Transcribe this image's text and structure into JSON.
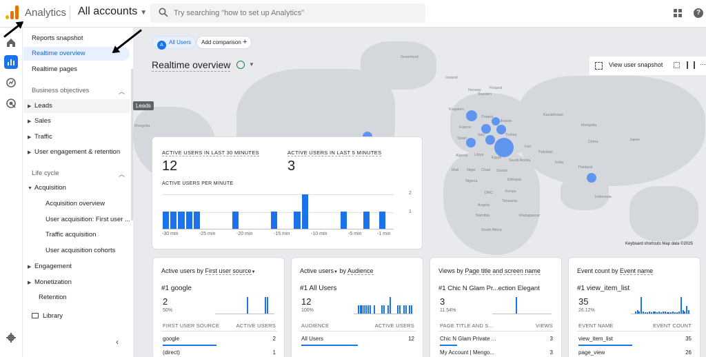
{
  "topbar": {
    "app_name": "Analytics",
    "account": "All accounts",
    "search_placeholder": "Try searching \"how to set up Analytics\""
  },
  "nav": {
    "reports_snapshot": "Reports snapshot",
    "realtime_overview": "Realtime overview",
    "realtime_pages": "Realtime pages",
    "business_objectives": "Business objectives",
    "bo_items": [
      "Leads",
      "Sales",
      "Traffic",
      "User engagement & retention"
    ],
    "life_cycle": "Life cycle",
    "acquisition": "Acquisition",
    "acq_items": [
      "Acquisition overview",
      "User acquisition: First user ...",
      "Traffic acquisition",
      "User acquisition cohorts"
    ],
    "engagement": "Engagement",
    "monetization": "Monetization",
    "retention": "Retention",
    "library": "Library"
  },
  "tooltip": "Leads",
  "main": {
    "chip_all_users": "All Users",
    "chip_all_users_letter": "A",
    "chip_add_comparison": "Add comparison",
    "page_title": "Realtime overview",
    "view_snapshot": "View user snapshot",
    "map_footer": "Keyboard shortcuts    Map data ©2025"
  },
  "map_labels": [
    "Greenland",
    "Iceland",
    "Norway",
    "Sweden",
    "Finland",
    "Kingdom",
    "Poland",
    "Ukraine",
    "Kazakhstan",
    "Mongolia",
    "France",
    "Spain",
    "Italy",
    "Turkey",
    "China",
    "Algeria",
    "Libya",
    "Egypt",
    "Iran",
    "Pakistan",
    "India",
    "Mali",
    "Niger",
    "Chad",
    "Sudan",
    "Nigeria",
    "Ethiopia",
    "DRC",
    "Kenya",
    "Tanzania",
    "Angola",
    "Namibia",
    "Madagascar",
    "South Africa",
    "Thailand",
    "Indonesia",
    "Saudi Arabia",
    "Japan",
    "Mongolia"
  ],
  "realtime": {
    "kpi1_label": "ACTIVE USERS IN LAST 30 MINUTES",
    "kpi1_value": "12",
    "kpi2_label": "ACTIVE USERS IN LAST 5 MINUTES",
    "kpi2_value": "3",
    "per_minute_label": "ACTIVE USERS PER MINUTE",
    "x_ticks": [
      "-30 min",
      "-25 min",
      "-20 min",
      "-15 min",
      "-10 min",
      "-5 min",
      "-1 min"
    ],
    "y_ticks": [
      "2",
      "1"
    ]
  },
  "chart_data": {
    "type": "bar",
    "title": "ACTIVE USERS PER MINUTE",
    "categories": [
      "-30",
      "-29",
      "-28",
      "-27",
      "-26",
      "-25",
      "-24",
      "-23",
      "-22",
      "-21",
      "-20",
      "-19",
      "-18",
      "-17",
      "-16",
      "-15",
      "-14",
      "-13",
      "-12",
      "-11",
      "-10",
      "-9",
      "-8",
      "-7",
      "-6",
      "-5",
      "-4",
      "-3",
      "-2",
      "-1"
    ],
    "values": [
      1,
      1,
      1,
      1,
      1,
      0,
      0,
      0,
      0,
      1,
      0,
      0,
      0,
      0,
      1,
      0,
      0,
      1,
      2,
      0,
      0,
      0,
      0,
      1,
      0,
      0,
      1,
      0,
      1,
      0
    ],
    "ylim": [
      0,
      2
    ]
  },
  "cards": [
    {
      "title_prefix": "Active users by ",
      "title_dim": "First user source",
      "top": "#1  google",
      "value": "2",
      "pct": "50%",
      "col1": "FIRST USER SOURCE",
      "col2": "ACTIVE USERS",
      "rows": [
        {
          "name": "google",
          "value": "2",
          "share": 0.95
        },
        {
          "name": "(direct)",
          "value": "1",
          "share": 0.45
        }
      ],
      "spark": [
        0,
        0,
        0,
        0,
        0,
        0,
        0,
        0,
        0,
        0,
        0,
        0,
        0,
        0,
        0,
        0,
        1,
        0,
        0,
        0,
        0,
        0,
        0,
        0,
        0,
        1,
        1,
        0,
        0,
        0
      ]
    },
    {
      "title_prefix": "Active users",
      "title_dim": "Audience",
      "title_mid": " by ",
      "top": "#1  All Users",
      "value": "12",
      "pct": "100%",
      "col1": "AUDIENCE",
      "col2": "ACTIVE USERS",
      "rows": [
        {
          "name": "All Users",
          "value": "12",
          "share": 1
        }
      ],
      "spark": [
        0,
        0,
        1,
        1,
        1,
        1,
        1,
        1,
        1,
        0,
        1,
        0,
        0,
        0,
        1,
        1,
        0,
        1,
        2,
        0,
        0,
        0,
        1,
        1,
        0,
        1,
        1,
        0,
        1,
        1
      ]
    },
    {
      "title_prefix": "Views by ",
      "title_dim": "Page title and screen name",
      "top": "#1  Chic N Glam Pr...ection Elegant",
      "value": "3",
      "pct": "11.54%",
      "col1": "PAGE TITLE AND S...",
      "col2": "VIEWS",
      "rows": [
        {
          "name": "Chic N Glam Private ...",
          "value": "3",
          "share": 0.3
        },
        {
          "name": "My Account | Mengo...",
          "value": "3",
          "share": 0.3
        }
      ],
      "spark": [
        0,
        0,
        0,
        0,
        0,
        0,
        0,
        0,
        0,
        0,
        0,
        0,
        1,
        0,
        0,
        0,
        0,
        0,
        0,
        0,
        0,
        0,
        0,
        0,
        0,
        0,
        0,
        0,
        0,
        0
      ]
    },
    {
      "title_prefix": "Event count by ",
      "title_dim": "Event name",
      "top": "#1  view_item_list",
      "value": "35",
      "pct": "26.12%",
      "col1": "EVENT NAME",
      "col2": "EVENT COUNT",
      "rows": [
        {
          "name": "view_item_list",
          "value": "35",
          "share": 0.95
        },
        {
          "name": "page_view",
          "value": "26",
          "share": 0.7
        }
      ],
      "spark": [
        0,
        0,
        0.1,
        0.2,
        0.1,
        0.9,
        0.1,
        0.05,
        0.05,
        0.1,
        0.05,
        0.1,
        0.1,
        0.05,
        0.1,
        0.05,
        0.1,
        0.1,
        0.05,
        0.05,
        0.05,
        0.1,
        0.05,
        0.05,
        0.1,
        0.9,
        0.2,
        0.1,
        0.4,
        0.2
      ]
    }
  ],
  "colors": {
    "accent": "#1a73e8",
    "logo": "#f9ab00",
    "nav_active_bg": "#e8f0fe"
  }
}
